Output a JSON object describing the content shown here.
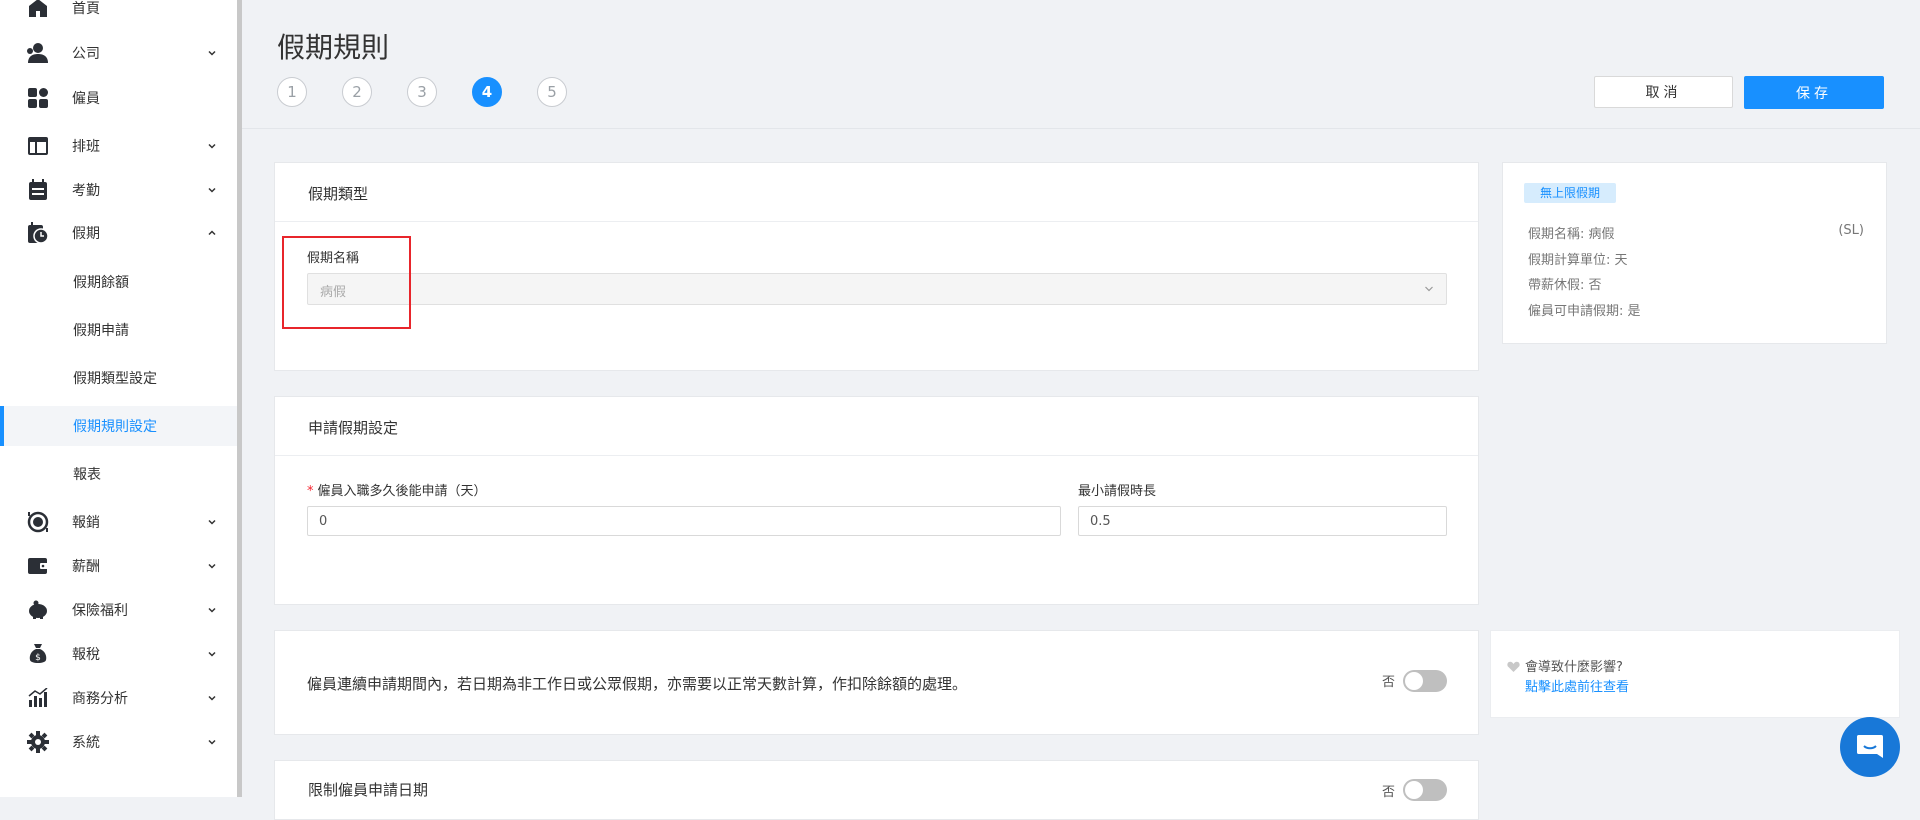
{
  "sidebar": {
    "items": [
      {
        "label": "首頁",
        "icon": "home-icon"
      },
      {
        "label": "公司",
        "icon": "users-icon"
      },
      {
        "label": "僱員",
        "icon": "apps-icon"
      },
      {
        "label": "排班",
        "icon": "layout-icon"
      },
      {
        "label": "考勤",
        "icon": "calendar-icon"
      },
      {
        "label": "假期",
        "icon": "calendar-clock-icon"
      },
      {
        "label": "報銷",
        "icon": "money-cycle-icon"
      },
      {
        "label": "薪酬",
        "icon": "wallet-icon"
      },
      {
        "label": "保險福利",
        "icon": "piggy-bank-icon"
      },
      {
        "label": "報稅",
        "icon": "money-bag-icon"
      },
      {
        "label": "商務分析",
        "icon": "bar-chart-icon"
      },
      {
        "label": "系統",
        "icon": "gear-icon"
      }
    ],
    "leave_sub": [
      "假期餘額",
      "假期申請",
      "假期類型設定",
      "假期規則設定",
      "報表"
    ]
  },
  "header": {
    "title": "假期規則",
    "steps": [
      "1",
      "2",
      "3",
      "4",
      "5"
    ],
    "active_step": "4",
    "cancel_label": "取消",
    "save_label": "保存"
  },
  "leave_type": {
    "title": "假期類型",
    "name_label": "假期名稱",
    "name_value": "病假"
  },
  "apply_settings": {
    "title": "申請假期設定",
    "onboard_label": "僱員入職多久後能申請（天）",
    "onboard_value": "0",
    "min_label": "最小請假時長",
    "min_value": "0.5"
  },
  "holiday_rule": {
    "text": "僱員連續申請期間內，若日期為非工作日或公眾假期，亦需要以正常天數計算，作扣除餘額的處理。",
    "toggle_label": "否"
  },
  "limit_date": {
    "title": "限制僱員申請日期",
    "toggle_label": "否"
  },
  "info": {
    "tag": "無上限假期",
    "name_line": "假期名稱: 病假",
    "code": "(SL)",
    "unit_line": "假期計算單位: 天",
    "paid_line": "帶薪休假: 否",
    "apply_line": "僱員可申請假期: 是"
  },
  "impact": {
    "question": "會導致什麼影響?",
    "link": "點擊此處前往查看"
  },
  "colors": {
    "accent": "#1890ff",
    "highlight": "#e8252b",
    "chat": "#1878d8"
  }
}
